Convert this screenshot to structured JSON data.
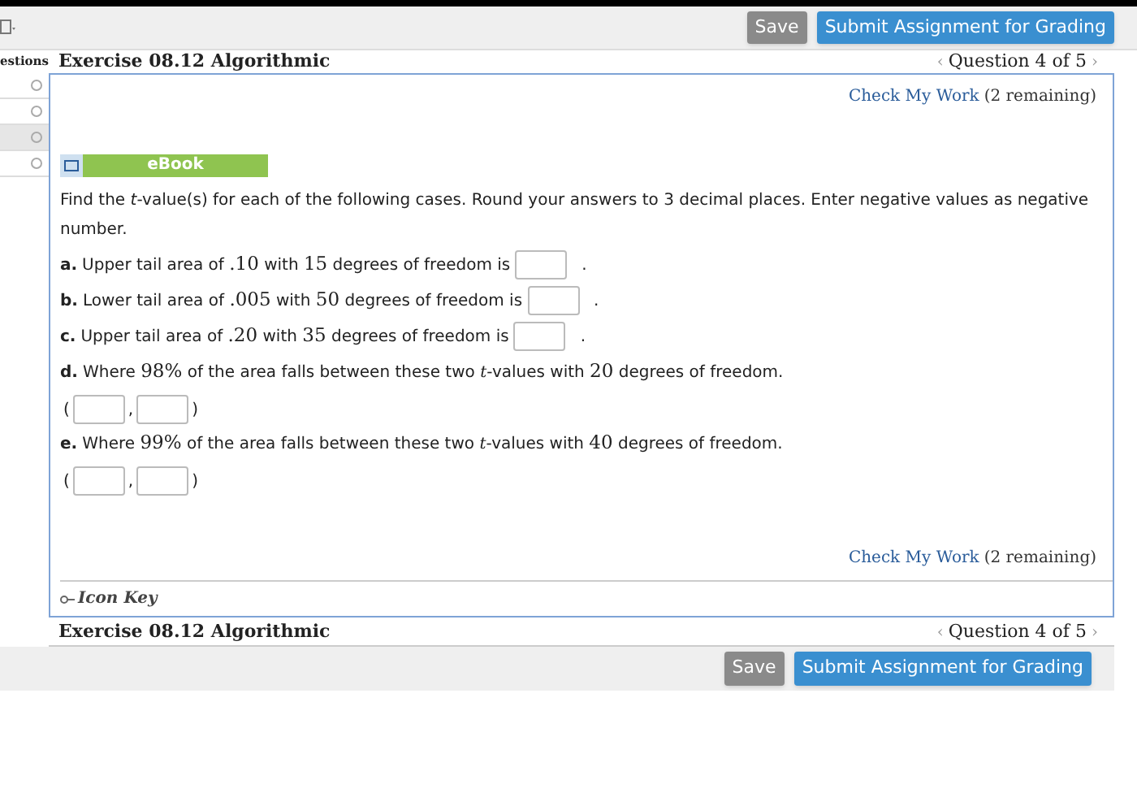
{
  "toolbar": {
    "save": "Save",
    "submit": "Submit Assignment for Grading"
  },
  "sidebar": {
    "title": "estions",
    "items": [
      {
        "selected": false
      },
      {
        "selected": false
      },
      {
        "selected": true
      },
      {
        "selected": false
      }
    ]
  },
  "header": {
    "title": "Exercise 08.12 Algorithmic",
    "prev": "‹",
    "nav": "Question 4 of 5",
    "next": "›"
  },
  "check_top": {
    "link": "Check My Work",
    "note": "(2 remaining)"
  },
  "ebook": "eBook",
  "intro": "Find the *t*-value(s) for each of the following cases. Round your answers to 3 decimal places. Enter negative values as negative number.",
  "parts": [
    {
      "label": "a.",
      "segments": [
        {
          "kind": "text",
          "text": "Upper tail area of "
        },
        {
          "kind": "math",
          "text": ".10"
        },
        {
          "kind": "text",
          "text": " with "
        },
        {
          "kind": "math",
          "text": "15"
        },
        {
          "kind": "text",
          "text": " degrees of freedom is"
        }
      ],
      "answer": {
        "kind": "single",
        "after": "."
      }
    },
    {
      "label": "b.",
      "segments": [
        {
          "kind": "text",
          "text": "Lower tail area of "
        },
        {
          "kind": "math",
          "text": ".005"
        },
        {
          "kind": "text",
          "text": " with "
        },
        {
          "kind": "math",
          "text": "50"
        },
        {
          "kind": "text",
          "text": " degrees of freedom is"
        }
      ],
      "answer": {
        "kind": "single",
        "after": "."
      }
    },
    {
      "label": "c.",
      "segments": [
        {
          "kind": "text",
          "text": "Upper tail area of "
        },
        {
          "kind": "math",
          "text": ".20"
        },
        {
          "kind": "text",
          "text": " with "
        },
        {
          "kind": "math",
          "text": "35"
        },
        {
          "kind": "text",
          "text": " degrees of freedom is"
        }
      ],
      "answer": {
        "kind": "single",
        "after": "."
      }
    },
    {
      "label": "d.",
      "segments": [
        {
          "kind": "text",
          "text": "Where "
        },
        {
          "kind": "math",
          "text": "98%"
        },
        {
          "kind": "text",
          "text": " of the area falls between these two "
        },
        {
          "kind": "italic",
          "text": "t"
        },
        {
          "kind": "text",
          "text": "-values with "
        },
        {
          "kind": "math",
          "text": "20"
        },
        {
          "kind": "text",
          "text": " degrees of freedom."
        }
      ],
      "answer": {
        "kind": "pair",
        "open": "(",
        "separator": ",",
        "close": ")"
      }
    },
    {
      "label": "e.",
      "segments": [
        {
          "kind": "text",
          "text": "Where "
        },
        {
          "kind": "math",
          "text": "99%"
        },
        {
          "kind": "text",
          "text": " of the area falls between these two "
        },
        {
          "kind": "italic",
          "text": "t"
        },
        {
          "kind": "text",
          "text": "-values with "
        },
        {
          "kind": "math",
          "text": "40"
        },
        {
          "kind": "text",
          "text": " degrees of freedom."
        }
      ],
      "answer": {
        "kind": "pair",
        "open": "(",
        "separator": ",",
        "close": ")"
      }
    }
  ],
  "check_bottom": {
    "link": "Check My Work",
    "note": "(2 remaining)"
  },
  "icon_key": "Icon Key",
  "footer_header": {
    "title": "Exercise 08.12 Algorithmic",
    "prev": "‹",
    "nav": "Question 4 of 5",
    "next": "›"
  },
  "footer": {
    "save": "Save",
    "submit": "Submit Assignment for Grading"
  }
}
